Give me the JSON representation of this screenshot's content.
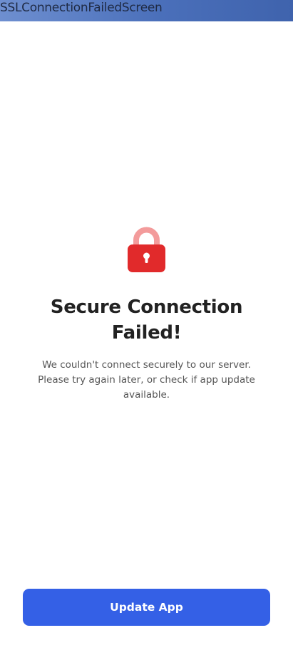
{
  "appbar": {
    "title": "SSLConnectionFailedScreen"
  },
  "error": {
    "icon": "lock-icon",
    "title_line1": "Secure Connection",
    "title_line2": "Failed!",
    "message": "We couldn't connect securely to our server. Please try again later, or check if app update available."
  },
  "actions": {
    "update_label": "Update App"
  },
  "colors": {
    "primary": "#3460e6",
    "lock_body": "#e12a2b",
    "lock_shackle": "#f39b9b",
    "appbar": "#4a6fba"
  }
}
